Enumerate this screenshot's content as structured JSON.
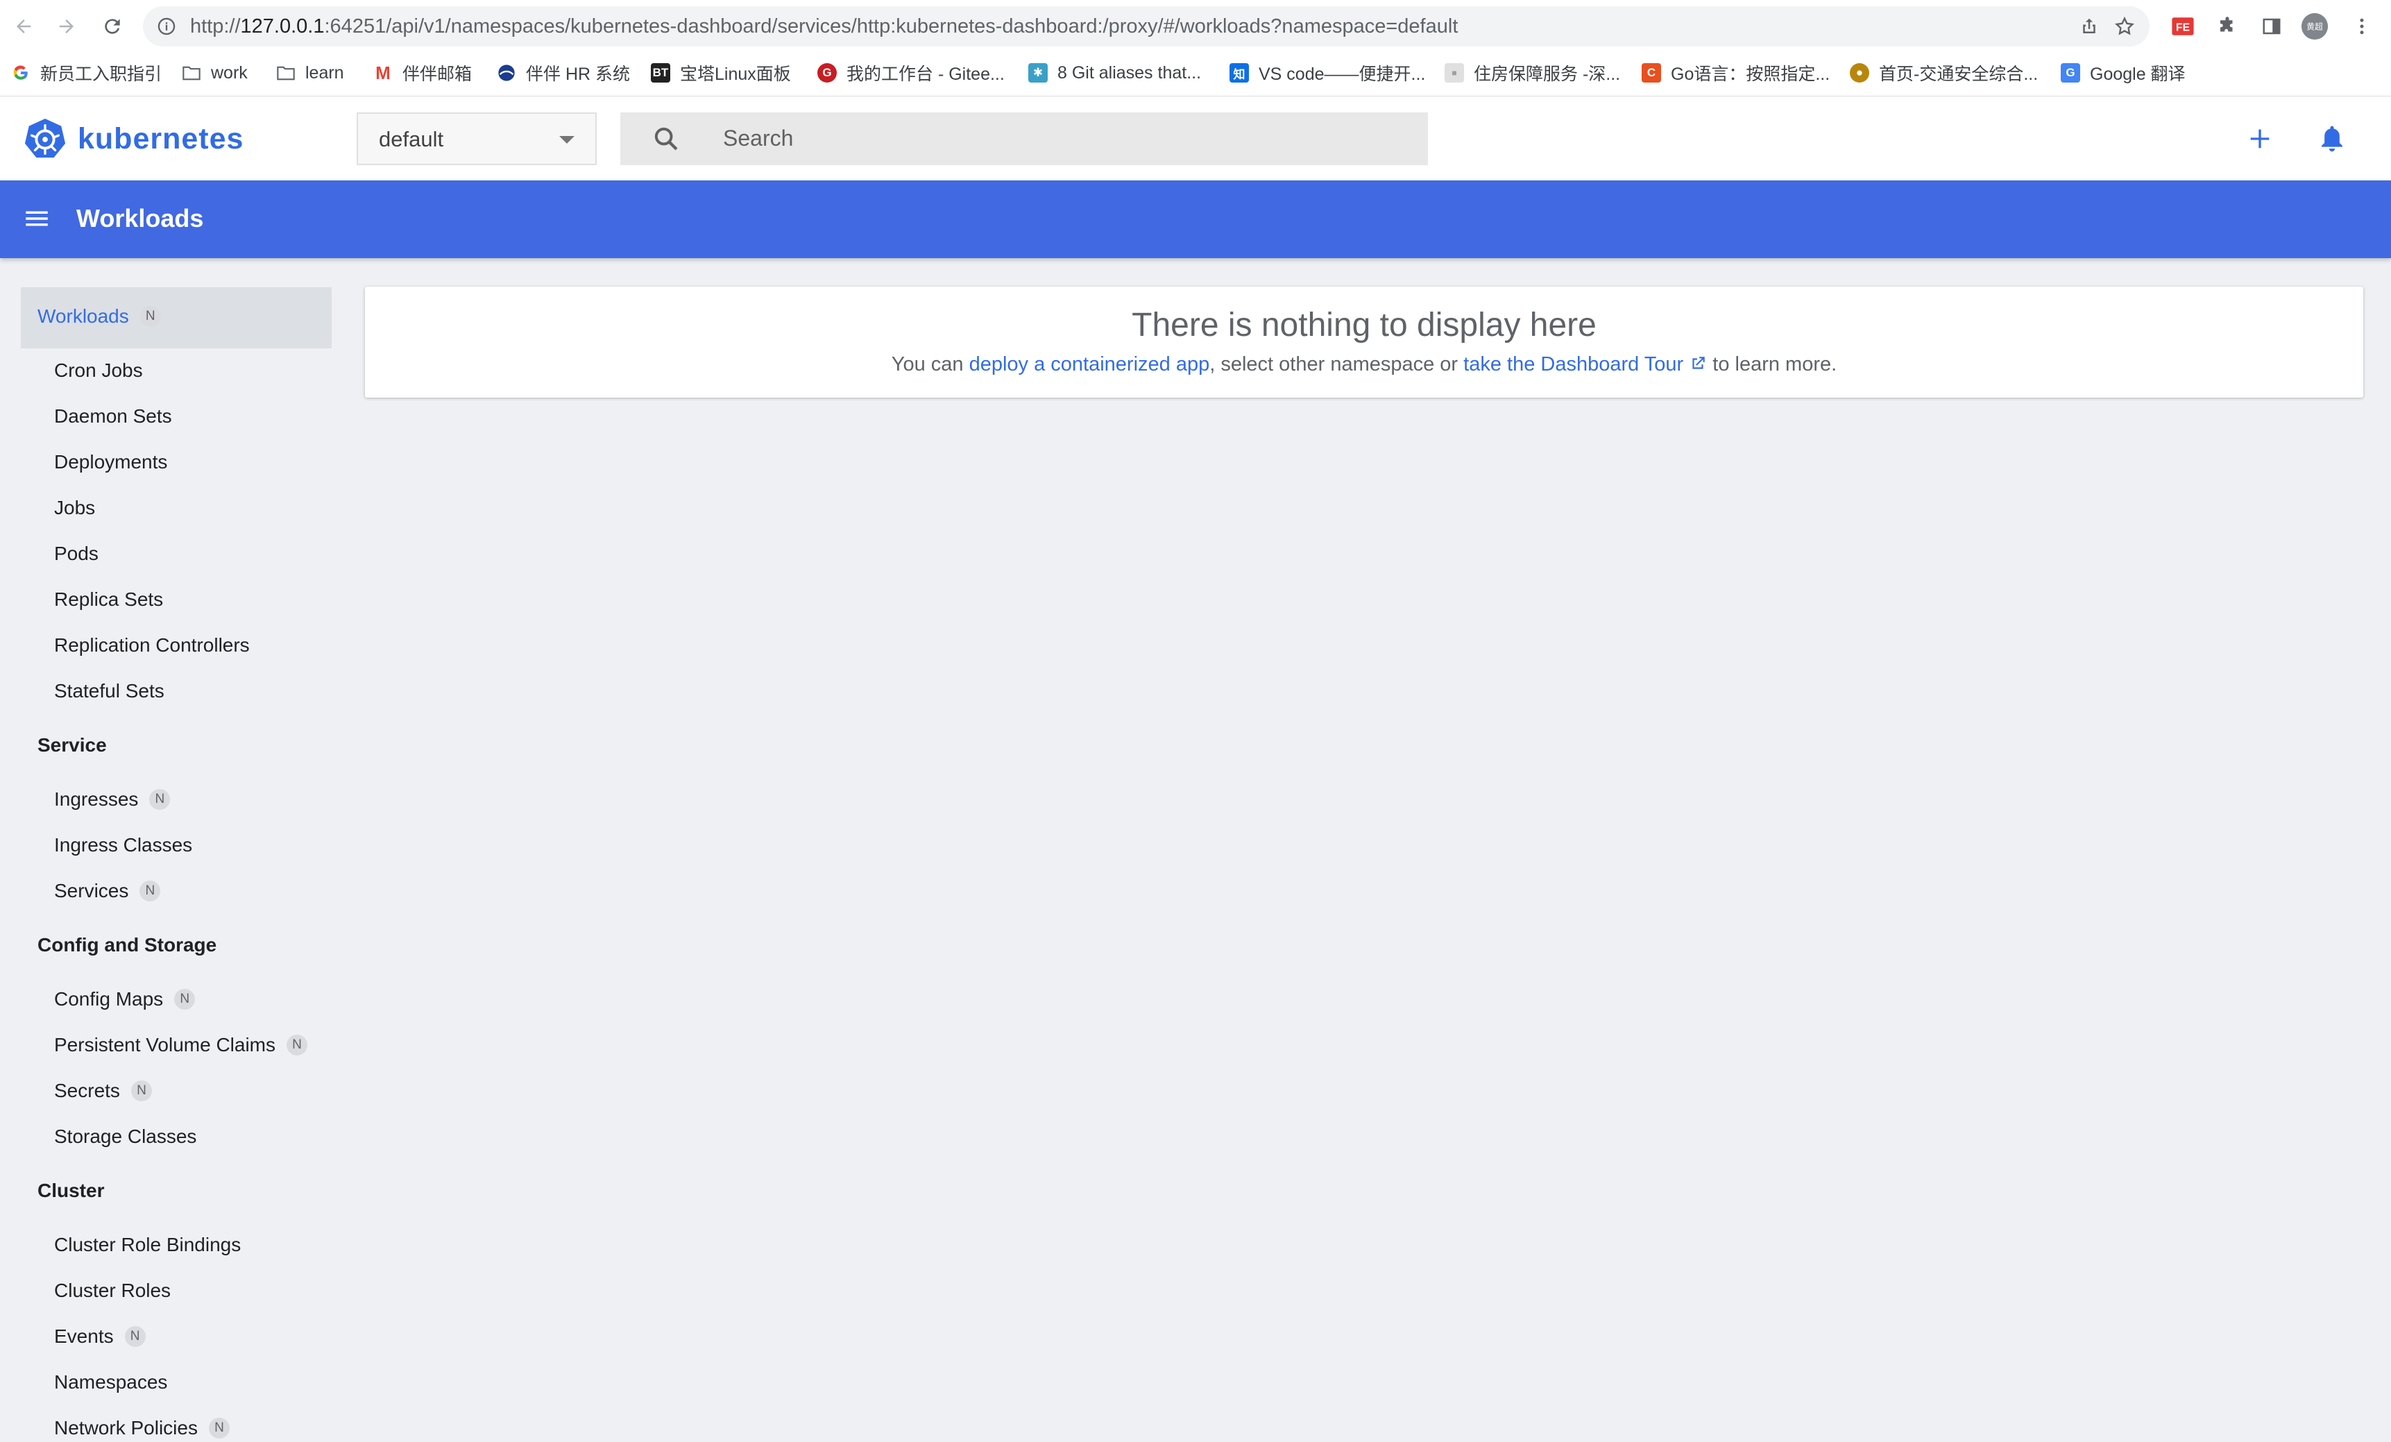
{
  "browser": {
    "url_prefix": "http://",
    "url_host": "127.0.0.1",
    "url_rest": ":64251/api/v1/namespaces/kubernetes-dashboard/services/http:kubernetes-dashboard:/proxy/#/workloads?namespace=default",
    "profile_label": "黄超",
    "bookmarks": [
      {
        "label": "新员工入职指引",
        "icon": "google-g-icon",
        "color": "#4285f4"
      },
      {
        "label": "work",
        "icon": "folder-icon"
      },
      {
        "label": "learn",
        "icon": "folder-icon"
      },
      {
        "label": "伴伴邮箱",
        "icon": "gmail-m-icon",
        "color": "#ea4335"
      },
      {
        "label": "伴伴 HR 系统",
        "icon": "hr-logo-icon",
        "color": "#1a3d8f"
      },
      {
        "label": "宝塔Linux面板",
        "icon": "bt-icon",
        "color": "#222222"
      },
      {
        "label": "我的工作台 - Gitee...",
        "icon": "gitee-icon",
        "color": "#c71d23"
      },
      {
        "label": "8 Git aliases that...",
        "icon": "dev-icon",
        "color": "#3aa0c9"
      },
      {
        "label": "VS code——便捷开...",
        "icon": "zhihu-icon",
        "color": "#0e6fe5"
      },
      {
        "label": "住房保障服务 -深...",
        "icon": "gov-icon",
        "color": "#9e9e9e"
      },
      {
        "label": "Go语言：按照指定...",
        "icon": "csdn-c-icon",
        "color": "#e8501f"
      },
      {
        "label": "首页-交通安全综合...",
        "icon": "safety-icon",
        "color": "#b8860b"
      },
      {
        "label": "Google 翻译",
        "icon": "translate-icon",
        "color": "#4285f4"
      }
    ]
  },
  "app": {
    "logo_text": "kubernetes",
    "namespace": "default",
    "search_placeholder": "Search",
    "page_title": "Workloads"
  },
  "sidebar": {
    "active": {
      "label": "Workloads",
      "badge": "N"
    },
    "workloads": [
      "Cron Jobs",
      "Daemon Sets",
      "Deployments",
      "Jobs",
      "Pods",
      "Replica Sets",
      "Replication Controllers",
      "Stateful Sets"
    ],
    "service_heading": "Service",
    "service": [
      {
        "label": "Ingresses",
        "badge": "N"
      },
      {
        "label": "Ingress Classes"
      },
      {
        "label": "Services",
        "badge": "N"
      }
    ],
    "config_heading": "Config and Storage",
    "config": [
      {
        "label": "Config Maps",
        "badge": "N"
      },
      {
        "label": "Persistent Volume Claims",
        "badge": "N"
      },
      {
        "label": "Secrets",
        "badge": "N"
      },
      {
        "label": "Storage Classes"
      }
    ],
    "cluster_heading": "Cluster",
    "cluster": [
      {
        "label": "Cluster Role Bindings"
      },
      {
        "label": "Cluster Roles"
      },
      {
        "label": "Events",
        "badge": "N"
      },
      {
        "label": "Namespaces"
      },
      {
        "label": "Network Policies",
        "badge": "N"
      }
    ]
  },
  "empty_state": {
    "heading": "There is nothing to display here",
    "text_before": "You can ",
    "link1": "deploy a containerized app",
    "text_middle": ", select other namespace or ",
    "link2": "take the Dashboard Tour",
    "text_after": " to learn more."
  },
  "colors": {
    "accent": "#326ce5",
    "toolbar": "#4169e1",
    "background": "#eef0f3"
  }
}
